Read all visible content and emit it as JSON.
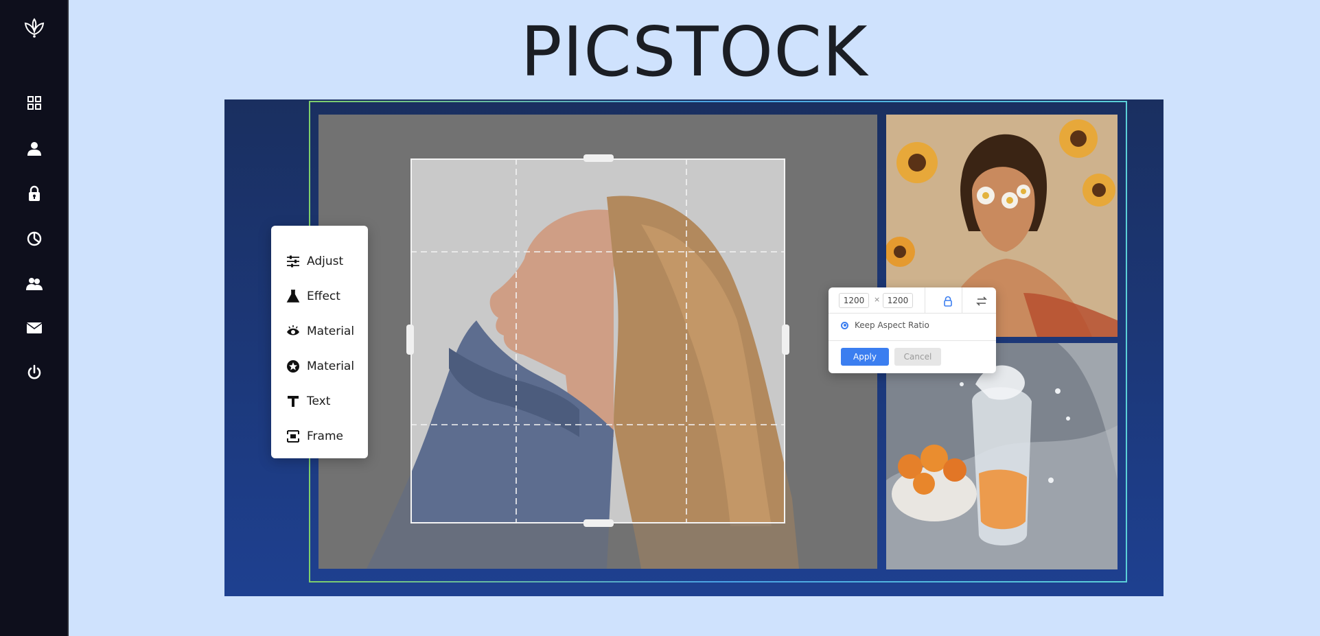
{
  "app": {
    "title": "PICSTOCK"
  },
  "sidebar": {
    "logo_icon": "leaf-logo-icon",
    "items": [
      {
        "icon": "dashboard-grid-icon"
      },
      {
        "icon": "user-icon"
      },
      {
        "icon": "lock-icon"
      },
      {
        "icon": "pie-chart-icon"
      },
      {
        "icon": "users-group-icon"
      },
      {
        "icon": "mail-icon"
      },
      {
        "icon": "power-icon"
      }
    ]
  },
  "tools": [
    {
      "label": "Adjust",
      "icon": "sliders-icon"
    },
    {
      "label": "Effect",
      "icon": "flask-icon"
    },
    {
      "label": "Material",
      "icon": "eye-icon"
    },
    {
      "label": "Material",
      "icon": "badge-icon"
    },
    {
      "label": "Text",
      "icon": "text-icon"
    },
    {
      "label": "Frame",
      "icon": "frame-icon"
    }
  ],
  "resize": {
    "width": "1200",
    "height": "1200",
    "separator": "×",
    "keep_ratio_label": "Keep Aspect Ratio",
    "apply_label": "Apply",
    "cancel_label": "Cancel"
  },
  "colors": {
    "sidebar_bg": "#0e0f1c",
    "page_bg": "#cfe2fd",
    "stage_bg": "#1e4090",
    "accent": "#3b7ef0"
  }
}
